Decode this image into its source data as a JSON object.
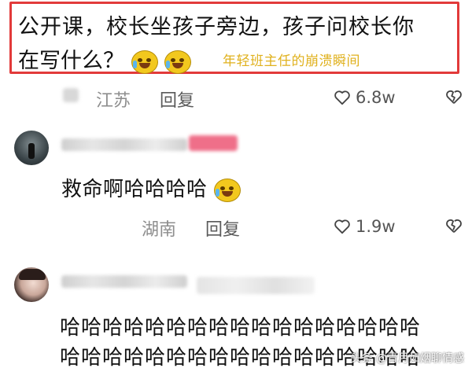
{
  "highlight": {
    "line1": "公开课，校长坐孩子旁边，孩子问校长你",
    "line2": "在写什么？",
    "caption": "年轻班主任的崩溃瞬间"
  },
  "comment1": {
    "location": "江苏",
    "reply": "回复",
    "likes": "6.8w"
  },
  "comment2": {
    "text": "救命啊哈哈哈哈",
    "location": "湖南",
    "reply": "回复",
    "likes": "1.9w"
  },
  "comment3": {
    "line1": "哈哈哈哈哈哈哈哈哈哈哈哈哈哈哈哈哈",
    "line2": "哈哈哈哈哈哈哈哈哈哈哈哈哈哈哈哈哈"
  },
  "watermark": "头条 @青月如烟聊情感",
  "colors": {
    "highlight_border": "#e23a3a",
    "caption": "#e0b11d",
    "meta": "#8e8e8e"
  },
  "icons": [
    "crying-laughing-emoji-icon",
    "heart-icon",
    "broken-heart-icon"
  ]
}
